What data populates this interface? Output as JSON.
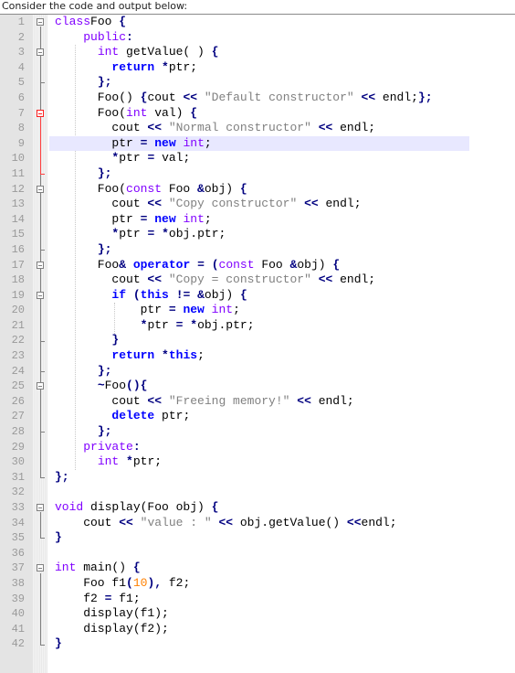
{
  "caption": "Consider the code and output below:",
  "editor": {
    "highlighted_line": 9,
    "lines": [
      {
        "n": "1",
        "fold": "open",
        "tokens": [
          [
            "ty",
            "class"
          ],
          [
            "",
            "Foo "
          ],
          [
            "op",
            "{"
          ]
        ]
      },
      {
        "n": "2",
        "tokens": [
          [
            "",
            "    "
          ],
          [
            "ty",
            "public"
          ],
          [
            "op",
            ":"
          ]
        ]
      },
      {
        "n": "3",
        "fold": "open",
        "tokens": [
          [
            "",
            "      "
          ],
          [
            "ty",
            "int"
          ],
          [
            "",
            " getValue( ) "
          ],
          [
            "op",
            "{"
          ]
        ]
      },
      {
        "n": "4",
        "tokens": [
          [
            "",
            "        "
          ],
          [
            "kw",
            "return"
          ],
          [
            "",
            " "
          ],
          [
            "op",
            "*"
          ],
          [
            "",
            "ptr;"
          ]
        ]
      },
      {
        "n": "5",
        "tokens": [
          [
            "",
            "      "
          ],
          [
            "op",
            "};"
          ]
        ]
      },
      {
        "n": "6",
        "tokens": [
          [
            "",
            "      Foo() "
          ],
          [
            "op",
            "{"
          ],
          [
            "",
            "cout "
          ],
          [
            "op",
            "<<"
          ],
          [
            "",
            " "
          ],
          [
            "str",
            "\"Default constructor\""
          ],
          [
            "",
            " "
          ],
          [
            "op",
            "<<"
          ],
          [
            "",
            " endl;"
          ],
          [
            "op",
            "};"
          ]
        ]
      },
      {
        "n": "7",
        "fold": "open-red",
        "tokens": [
          [
            "",
            "      Foo("
          ],
          [
            "ty",
            "int"
          ],
          [
            "",
            " val) "
          ],
          [
            "op",
            "{"
          ]
        ]
      },
      {
        "n": "8",
        "tokens": [
          [
            "",
            "        cout "
          ],
          [
            "op",
            "<<"
          ],
          [
            "",
            " "
          ],
          [
            "str",
            "\"Normal constructor\""
          ],
          [
            "",
            " "
          ],
          [
            "op",
            "<<"
          ],
          [
            "",
            " endl;"
          ]
        ]
      },
      {
        "n": "9",
        "tokens": [
          [
            "",
            "        ptr "
          ],
          [
            "op",
            "="
          ],
          [
            "",
            " "
          ],
          [
            "kw",
            "new"
          ],
          [
            "",
            " "
          ],
          [
            "ty",
            "int"
          ],
          [
            "",
            ";"
          ]
        ]
      },
      {
        "n": "10",
        "tokens": [
          [
            "",
            "        "
          ],
          [
            "op",
            "*"
          ],
          [
            "",
            "ptr "
          ],
          [
            "op",
            "="
          ],
          [
            "",
            " val;"
          ]
        ]
      },
      {
        "n": "11",
        "tokens": [
          [
            "",
            "      "
          ],
          [
            "op",
            "};"
          ]
        ]
      },
      {
        "n": "12",
        "fold": "open",
        "tokens": [
          [
            "",
            "      Foo("
          ],
          [
            "ty",
            "const"
          ],
          [
            "",
            " Foo "
          ],
          [
            "op",
            "&"
          ],
          [
            "",
            "obj) "
          ],
          [
            "op",
            "{"
          ]
        ]
      },
      {
        "n": "13",
        "tokens": [
          [
            "",
            "        cout "
          ],
          [
            "op",
            "<<"
          ],
          [
            "",
            " "
          ],
          [
            "str",
            "\"Copy constructor\""
          ],
          [
            "",
            " "
          ],
          [
            "op",
            "<<"
          ],
          [
            "",
            " endl;"
          ]
        ]
      },
      {
        "n": "14",
        "tokens": [
          [
            "",
            "        ptr "
          ],
          [
            "op",
            "="
          ],
          [
            "",
            " "
          ],
          [
            "kw",
            "new"
          ],
          [
            "",
            " "
          ],
          [
            "ty",
            "int"
          ],
          [
            "",
            ";"
          ]
        ]
      },
      {
        "n": "15",
        "tokens": [
          [
            "",
            "        "
          ],
          [
            "op",
            "*"
          ],
          [
            "",
            "ptr "
          ],
          [
            "op",
            "="
          ],
          [
            "",
            " "
          ],
          [
            "op",
            "*"
          ],
          [
            "",
            "obj.ptr;"
          ]
        ]
      },
      {
        "n": "16",
        "tokens": [
          [
            "",
            "      "
          ],
          [
            "op",
            "};"
          ]
        ]
      },
      {
        "n": "17",
        "fold": "open",
        "tokens": [
          [
            "",
            "      Foo"
          ],
          [
            "op",
            "&"
          ],
          [
            "",
            " "
          ],
          [
            "kw",
            "operator"
          ],
          [
            "",
            " "
          ],
          [
            "op",
            "="
          ],
          [
            "",
            " "
          ],
          [
            "op",
            "("
          ],
          [
            "ty",
            "const"
          ],
          [
            "",
            " Foo "
          ],
          [
            "op",
            "&"
          ],
          [
            "",
            "obj) "
          ],
          [
            "op",
            "{"
          ]
        ]
      },
      {
        "n": "18",
        "tokens": [
          [
            "",
            "        cout "
          ],
          [
            "op",
            "<<"
          ],
          [
            "",
            " "
          ],
          [
            "str",
            "\"Copy = constructor\""
          ],
          [
            "",
            " "
          ],
          [
            "op",
            "<<"
          ],
          [
            "",
            " endl;"
          ]
        ]
      },
      {
        "n": "19",
        "fold": "open",
        "tokens": [
          [
            "",
            "        "
          ],
          [
            "kw",
            "if"
          ],
          [
            "",
            " "
          ],
          [
            "op",
            "("
          ],
          [
            "kw",
            "this"
          ],
          [
            "",
            " "
          ],
          [
            "op",
            "!="
          ],
          [
            "",
            " "
          ],
          [
            "op",
            "&"
          ],
          [
            "",
            "obj) "
          ],
          [
            "op",
            "{"
          ]
        ]
      },
      {
        "n": "20",
        "tokens": [
          [
            "",
            "            ptr "
          ],
          [
            "op",
            "="
          ],
          [
            "",
            " "
          ],
          [
            "kw",
            "new"
          ],
          [
            "",
            " "
          ],
          [
            "ty",
            "int"
          ],
          [
            "",
            ";"
          ]
        ]
      },
      {
        "n": "21",
        "tokens": [
          [
            "",
            "            "
          ],
          [
            "op",
            "*"
          ],
          [
            "",
            "ptr "
          ],
          [
            "op",
            "="
          ],
          [
            "",
            " "
          ],
          [
            "op",
            "*"
          ],
          [
            "",
            "obj.ptr;"
          ]
        ]
      },
      {
        "n": "22",
        "tokens": [
          [
            "",
            "        "
          ],
          [
            "op",
            "}"
          ]
        ]
      },
      {
        "n": "23",
        "tokens": [
          [
            "",
            "        "
          ],
          [
            "kw",
            "return"
          ],
          [
            "",
            " "
          ],
          [
            "op",
            "*"
          ],
          [
            "kw",
            "this"
          ],
          [
            "",
            ";"
          ]
        ]
      },
      {
        "n": "24",
        "tokens": [
          [
            "",
            "      "
          ],
          [
            "op",
            "};"
          ]
        ]
      },
      {
        "n": "25",
        "fold": "open",
        "tokens": [
          [
            "",
            "      "
          ],
          [
            "op",
            "~"
          ],
          [
            "",
            "Foo"
          ],
          [
            "op",
            "(){"
          ]
        ]
      },
      {
        "n": "26",
        "tokens": [
          [
            "",
            "        cout "
          ],
          [
            "op",
            "<<"
          ],
          [
            "",
            " "
          ],
          [
            "str",
            "\"Freeing memory!\""
          ],
          [
            "",
            " "
          ],
          [
            "op",
            "<<"
          ],
          [
            "",
            " endl;"
          ]
        ]
      },
      {
        "n": "27",
        "tokens": [
          [
            "",
            "        "
          ],
          [
            "kw",
            "delete"
          ],
          [
            "",
            " ptr;"
          ]
        ]
      },
      {
        "n": "28",
        "tokens": [
          [
            "",
            "      "
          ],
          [
            "op",
            "};"
          ]
        ]
      },
      {
        "n": "29",
        "tokens": [
          [
            "",
            "    "
          ],
          [
            "ty",
            "private"
          ],
          [
            "op",
            ":"
          ]
        ]
      },
      {
        "n": "30",
        "tokens": [
          [
            "",
            "      "
          ],
          [
            "ty",
            "int"
          ],
          [
            "",
            " "
          ],
          [
            "op",
            "*"
          ],
          [
            "",
            "ptr;"
          ]
        ]
      },
      {
        "n": "31",
        "tokens": [
          [
            "op",
            "};"
          ]
        ]
      },
      {
        "n": "32",
        "tokens": []
      },
      {
        "n": "33",
        "fold": "open",
        "tokens": [
          [
            "ty",
            "void"
          ],
          [
            "",
            " display(Foo obj) "
          ],
          [
            "op",
            "{"
          ]
        ]
      },
      {
        "n": "34",
        "tokens": [
          [
            "",
            "    cout "
          ],
          [
            "op",
            "<<"
          ],
          [
            "",
            " "
          ],
          [
            "str",
            "\"value : \""
          ],
          [
            "",
            " "
          ],
          [
            "op",
            "<<"
          ],
          [
            "",
            " obj.getValue() "
          ],
          [
            "op",
            "<<"
          ],
          [
            "",
            "endl;"
          ]
        ]
      },
      {
        "n": "35",
        "tokens": [
          [
            "op",
            "}"
          ]
        ]
      },
      {
        "n": "36",
        "tokens": []
      },
      {
        "n": "37",
        "fold": "open",
        "tokens": [
          [
            "ty",
            "int"
          ],
          [
            "",
            " main() "
          ],
          [
            "op",
            "{"
          ]
        ]
      },
      {
        "n": "38",
        "tokens": [
          [
            "",
            "    Foo f1"
          ],
          [
            "op",
            "("
          ],
          [
            "num",
            "10"
          ],
          [
            "op",
            "),"
          ],
          [
            "",
            " f2;"
          ]
        ]
      },
      {
        "n": "39",
        "tokens": [
          [
            "",
            "    f2 "
          ],
          [
            "op",
            "="
          ],
          [
            "",
            " f1;"
          ]
        ]
      },
      {
        "n": "40",
        "tokens": [
          [
            "",
            "    display(f1);"
          ]
        ]
      },
      {
        "n": "41",
        "tokens": [
          [
            "",
            "    display(f2);"
          ]
        ]
      },
      {
        "n": "42",
        "tokens": [
          [
            "op",
            "}"
          ]
        ]
      }
    ]
  }
}
